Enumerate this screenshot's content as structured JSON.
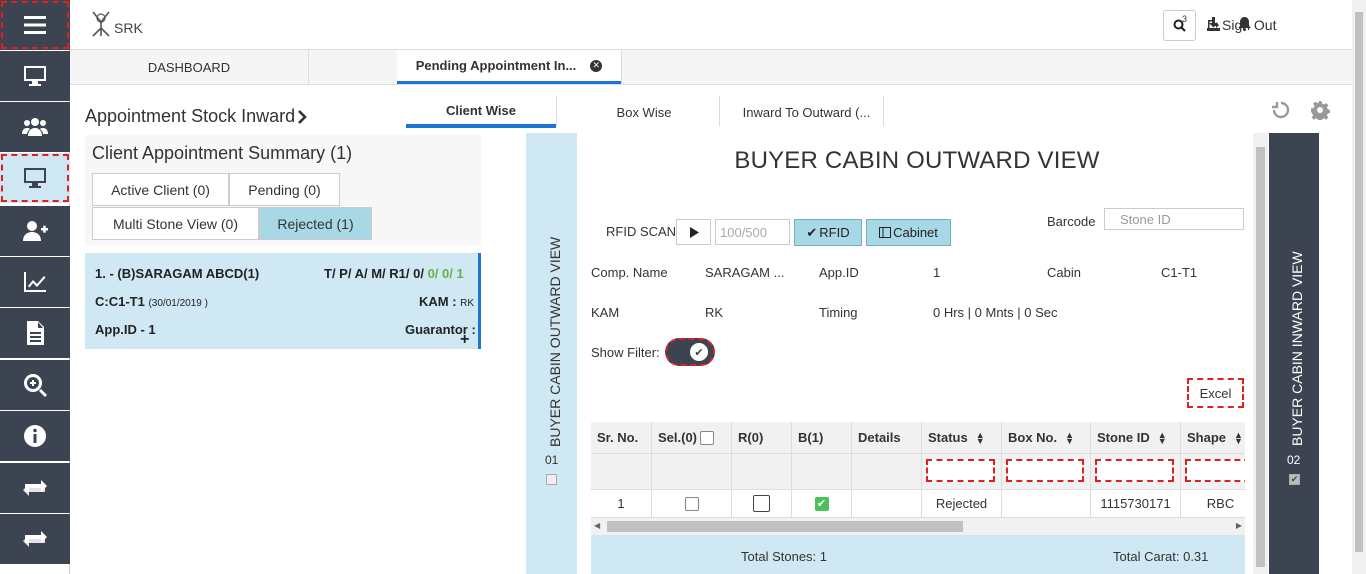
{
  "app": {
    "logo_text": "SRK"
  },
  "header": {
    "notification_count": "3",
    "signout_label": "Sign Out"
  },
  "doc_tabs": [
    {
      "label": "DASHBOARD"
    },
    {
      "label": "Pending Appointment In..."
    }
  ],
  "page": {
    "title": "Appointment Stock Inward",
    "subtabs": [
      "Client Wise",
      "Box Wise",
      "Inward To Outward (..."
    ]
  },
  "summary": {
    "title": "Client Appointment Summary (1)",
    "buttons": [
      "Active Client (0)",
      "Pending (0)",
      "Multi Stone View (0)",
      "Rejected (1)"
    ],
    "card": {
      "name": "1. - (B)SARAGAM ABCD(1)",
      "tpam_prefix": "T/ P/ A/ M/ R",
      "tpam_r": "1/",
      "tpam_0a": " 0/",
      "tpam_0b": " 0/",
      "tpam_0c": " 0/",
      "tpam_1": " 1",
      "cabin": "C:C1-T1",
      "date": "(30/01/2019 )",
      "kam_label": "KAM :",
      "kam_value": "RK",
      "app_id": "App.ID - 1",
      "guarantor": "Guarantor :"
    }
  },
  "side_left": {
    "label": "BUYER CABIN OUTWARD VIEW",
    "number": "01"
  },
  "side_right": {
    "label": "BUYER CABIN INWARD VIEW",
    "number": "02"
  },
  "outward": {
    "title": "BUYER CABIN OUTWARD VIEW",
    "rfid_label": "RFID SCAN",
    "count_value": "100/500",
    "rfid_button": "RFID",
    "cabinet_button": "Cabinet",
    "barcode_label": "Barcode",
    "barcode_placeholder": "Stone ID",
    "info": {
      "comp_name_label": "Comp. Name",
      "comp_name_value": "SARAGAM ...",
      "app_id_label": "App.ID",
      "app_id_value": "1",
      "cabin_label": "Cabin",
      "cabin_value": "C1-T1",
      "kam_label": "KAM",
      "kam_value": "RK",
      "timing_label": "Timing",
      "timing_value": "0 Hrs | 0 Mnts | 0 Sec"
    },
    "show_filter_label": "Show Filter:",
    "excel_button": "Excel",
    "grid": {
      "columns": [
        "Sr. No.",
        "Sel.(0)",
        "R(0)",
        "B(1)",
        "Details",
        "Status",
        "Box No.",
        "Stone ID",
        "Shape"
      ],
      "rows": [
        {
          "sr": "1",
          "status": "Rejected",
          "box": "",
          "stone_id": "1115730171",
          "shape": "RBC"
        }
      ]
    },
    "totals": {
      "stones": "Total Stones: 1",
      "carat": "Total Carat: 0.31"
    }
  }
}
